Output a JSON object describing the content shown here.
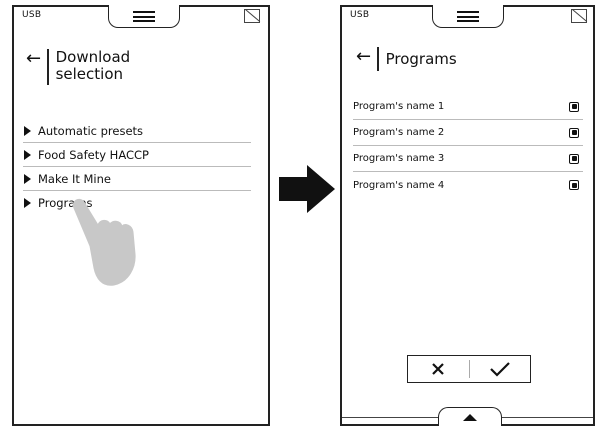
{
  "left_screen": {
    "status": "USB",
    "title_line1": "Download",
    "title_line2": "selection",
    "back_icon": "←",
    "items": [
      {
        "label": "Automatic presets"
      },
      {
        "label": "Food Safety HACCP"
      },
      {
        "label": "Make It Mine"
      },
      {
        "label": "Programs"
      }
    ]
  },
  "right_screen": {
    "status": "USB",
    "title": "Programs",
    "back_icon": "←",
    "items": [
      {
        "label": "Program's name 1"
      },
      {
        "label": "Program's name 2"
      },
      {
        "label": "Program's name 3"
      },
      {
        "label": "Program's name 4"
      }
    ],
    "cancel_icon": "✕",
    "confirm_icon": "✓"
  },
  "icons": {
    "menu": "menu-icon",
    "corner": "no-sd-card-icon",
    "hand": "hand-pointer-icon",
    "transition": "right-arrow-icon",
    "expand": "up-triangle-icon"
  }
}
